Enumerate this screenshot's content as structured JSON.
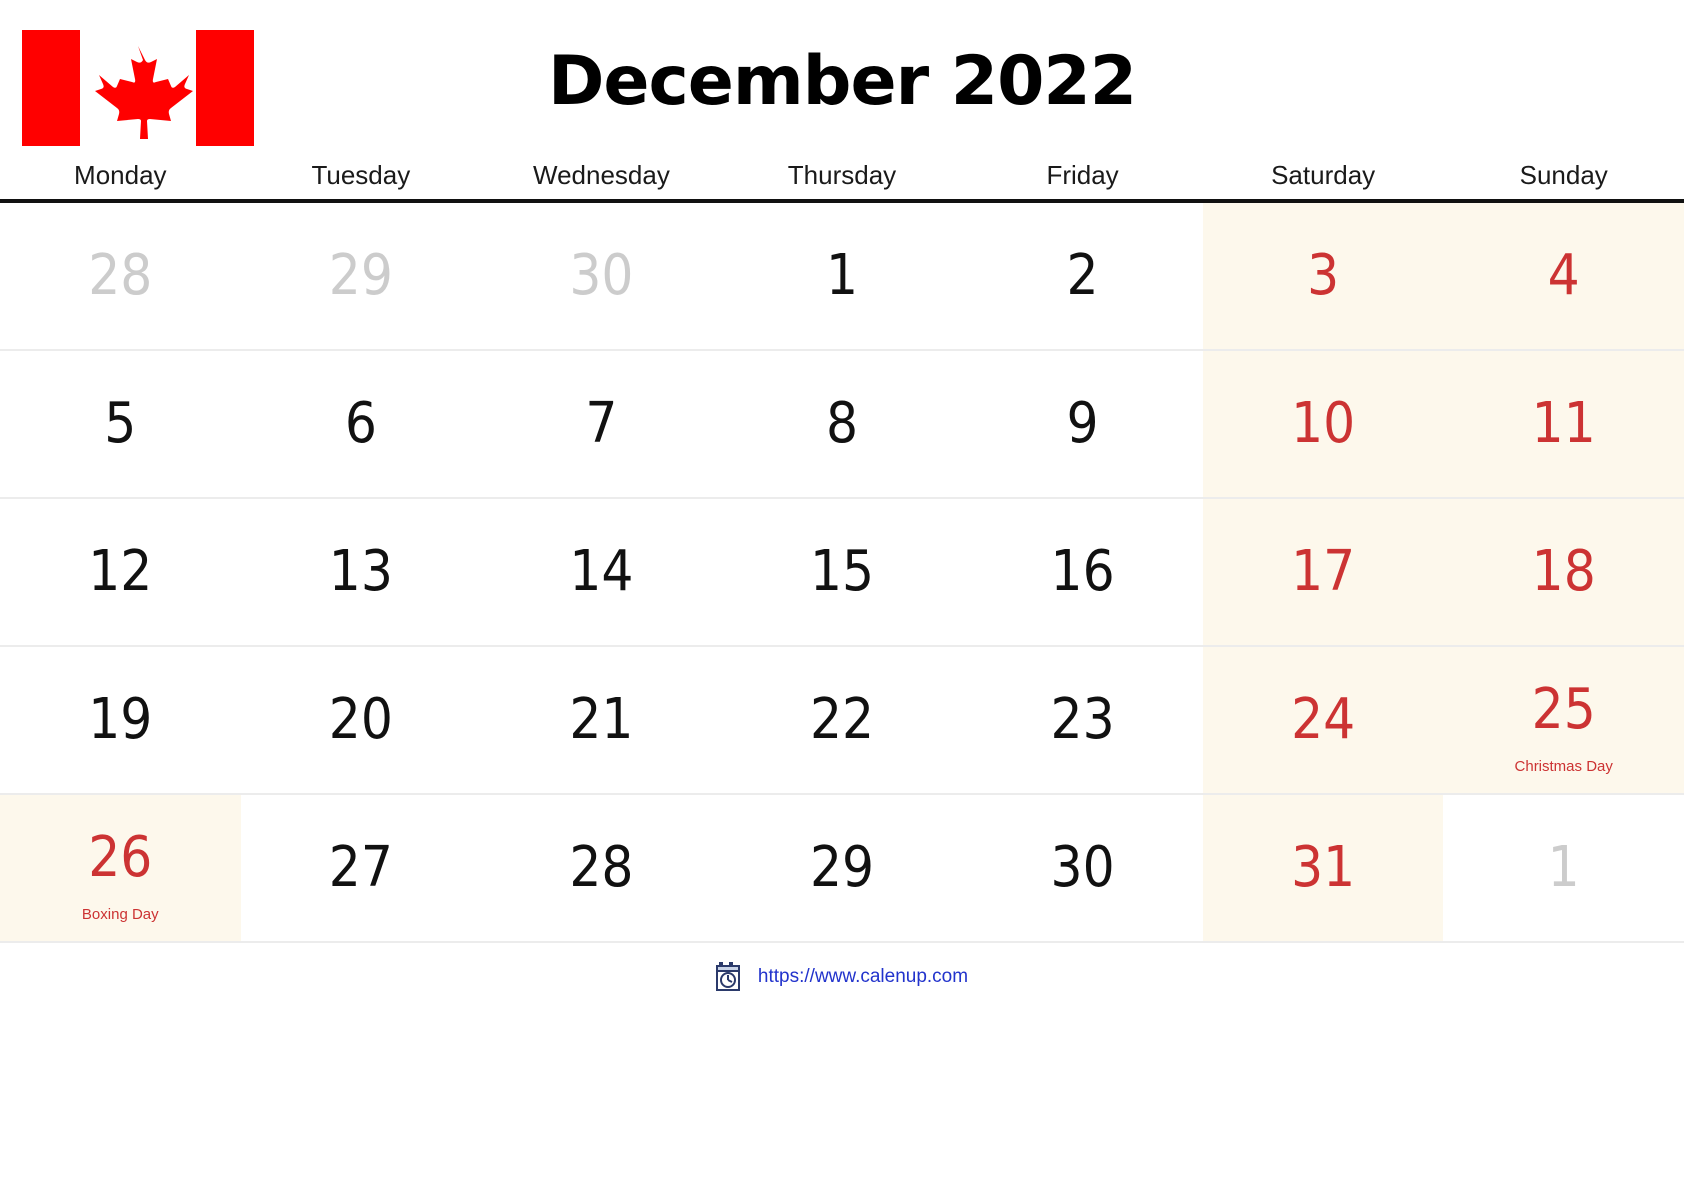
{
  "header": {
    "title": "December 2022",
    "flag_icon": "canada-flag-icon",
    "flag_colors": {
      "red": "#FF0000",
      "white": "#FFFFFF"
    }
  },
  "weekdays": [
    "Monday",
    "Tuesday",
    "Wednesday",
    "Thursday",
    "Friday",
    "Saturday",
    "Sunday"
  ],
  "colors": {
    "weekend_background": "#FDF8EC",
    "holiday_text": "#CC3333",
    "weekend_text": "#CC3333",
    "outside_month_text": "#CCCCCC",
    "weekday_text": "#111111",
    "header_rule": "#111111",
    "row_rule": "#ECECEC",
    "link": "#2233CC"
  },
  "weeks": [
    [
      {
        "num": "28",
        "style": "muted",
        "bg": "none",
        "label": ""
      },
      {
        "num": "29",
        "style": "muted",
        "bg": "none",
        "label": ""
      },
      {
        "num": "30",
        "style": "muted",
        "bg": "none",
        "label": ""
      },
      {
        "num": "1",
        "style": "normal",
        "bg": "none",
        "label": ""
      },
      {
        "num": "2",
        "style": "normal",
        "bg": "none",
        "label": ""
      },
      {
        "num": "3",
        "style": "red",
        "bg": "weekend",
        "label": ""
      },
      {
        "num": "4",
        "style": "red",
        "bg": "weekend",
        "label": ""
      }
    ],
    [
      {
        "num": "5",
        "style": "normal",
        "bg": "none",
        "label": ""
      },
      {
        "num": "6",
        "style": "normal",
        "bg": "none",
        "label": ""
      },
      {
        "num": "7",
        "style": "normal",
        "bg": "none",
        "label": ""
      },
      {
        "num": "8",
        "style": "normal",
        "bg": "none",
        "label": ""
      },
      {
        "num": "9",
        "style": "normal",
        "bg": "none",
        "label": ""
      },
      {
        "num": "10",
        "style": "red",
        "bg": "weekend",
        "label": ""
      },
      {
        "num": "11",
        "style": "red",
        "bg": "weekend",
        "label": ""
      }
    ],
    [
      {
        "num": "12",
        "style": "normal",
        "bg": "none",
        "label": ""
      },
      {
        "num": "13",
        "style": "normal",
        "bg": "none",
        "label": ""
      },
      {
        "num": "14",
        "style": "normal",
        "bg": "none",
        "label": ""
      },
      {
        "num": "15",
        "style": "normal",
        "bg": "none",
        "label": ""
      },
      {
        "num": "16",
        "style": "normal",
        "bg": "none",
        "label": ""
      },
      {
        "num": "17",
        "style": "red",
        "bg": "weekend",
        "label": ""
      },
      {
        "num": "18",
        "style": "red",
        "bg": "weekend",
        "label": ""
      }
    ],
    [
      {
        "num": "19",
        "style": "normal",
        "bg": "none",
        "label": ""
      },
      {
        "num": "20",
        "style": "normal",
        "bg": "none",
        "label": ""
      },
      {
        "num": "21",
        "style": "normal",
        "bg": "none",
        "label": ""
      },
      {
        "num": "22",
        "style": "normal",
        "bg": "none",
        "label": ""
      },
      {
        "num": "23",
        "style": "normal",
        "bg": "none",
        "label": ""
      },
      {
        "num": "24",
        "style": "red",
        "bg": "weekend",
        "label": ""
      },
      {
        "num": "25",
        "style": "red",
        "bg": "weekend",
        "label": "Christmas Day"
      }
    ],
    [
      {
        "num": "26",
        "style": "red",
        "bg": "holiday",
        "label": "Boxing Day"
      },
      {
        "num": "27",
        "style": "normal",
        "bg": "none",
        "label": ""
      },
      {
        "num": "28",
        "style": "normal",
        "bg": "none",
        "label": ""
      },
      {
        "num": "29",
        "style": "normal",
        "bg": "none",
        "label": ""
      },
      {
        "num": "30",
        "style": "normal",
        "bg": "none",
        "label": ""
      },
      {
        "num": "31",
        "style": "red",
        "bg": "weekend",
        "label": ""
      },
      {
        "num": "1",
        "style": "muted",
        "bg": "none",
        "label": ""
      }
    ]
  ],
  "footer": {
    "icon": "calendar-clock-icon",
    "url_text": "https://www.calenup.com"
  }
}
